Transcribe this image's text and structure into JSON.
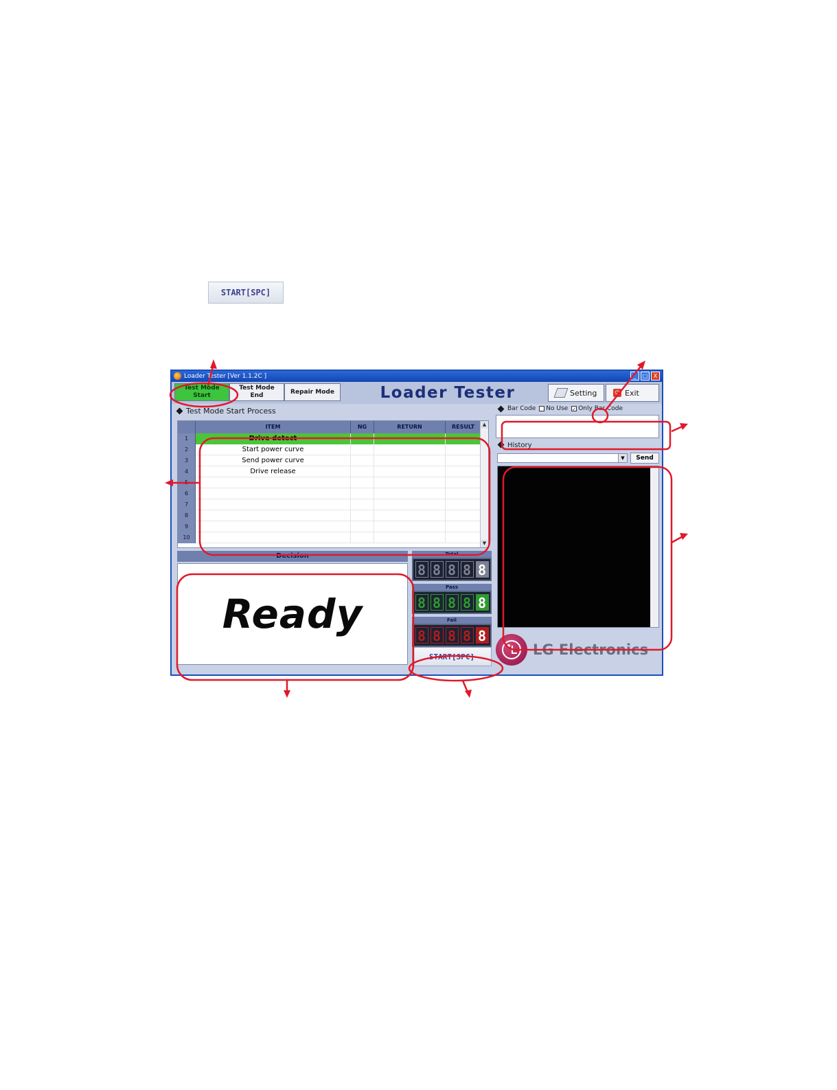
{
  "standalone_button": {
    "label": "START[SPC]"
  },
  "window": {
    "title": "Loader Tester [Ver 1.1.2C ]",
    "controls": [
      "_",
      "□",
      "X"
    ]
  },
  "toolbar": {
    "test_mode_start": "Test Mode\nStart",
    "test_mode_end": "Test Mode\nEnd",
    "repair_mode": "Repair Mode",
    "app_title": "Loader Tester",
    "setting": "Setting",
    "exit": "Exit"
  },
  "process": {
    "header": "Test Mode Start Process",
    "columns": [
      "ITEM",
      "NG",
      "RETURN",
      "RESULT"
    ],
    "rows": [
      {
        "num": "1",
        "item": "Drive detect"
      },
      {
        "num": "2",
        "item": "Start power curve"
      },
      {
        "num": "3",
        "item": "Send power curve"
      },
      {
        "num": "4",
        "item": "Drive release"
      },
      {
        "num": "5",
        "item": ""
      },
      {
        "num": "6",
        "item": ""
      },
      {
        "num": "7",
        "item": ""
      },
      {
        "num": "8",
        "item": ""
      },
      {
        "num": "9",
        "item": ""
      },
      {
        "num": "10",
        "item": ""
      }
    ]
  },
  "decision": {
    "header": "Decision",
    "status": "Ready"
  },
  "counters": {
    "total": {
      "label": "Total",
      "digits": "88888",
      "color": "#7d8292"
    },
    "pass": {
      "label": "Pass",
      "digits": "88888",
      "color": "#2f9a2f"
    },
    "fail": {
      "label": "Fail",
      "digits": "88888",
      "color": "#b01d1d"
    }
  },
  "start_button": {
    "label": "START[SPC]"
  },
  "barcode": {
    "header": "Bar Code",
    "no_use": "No Use",
    "only_barcode": "Only Bar Code",
    "only_barcode_checked": true
  },
  "history": {
    "header": "History",
    "send": "Send"
  },
  "brand": {
    "name": "LG Electronics"
  },
  "colors": {
    "active_mode": "#3ec43e",
    "selected_row": "#4cc43a",
    "annotation": "#e0192a",
    "title_text": "#1c2f7a"
  }
}
